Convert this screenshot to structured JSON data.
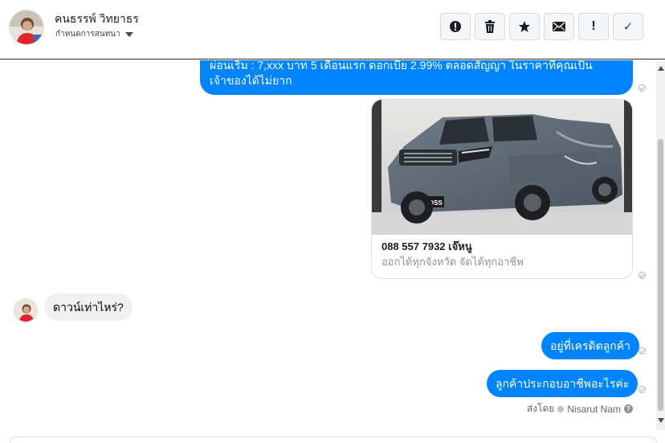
{
  "header": {
    "contact_name": "คนธรรพ์ วิทยาธร",
    "label_dropdown": "กำหนดการสนทนา",
    "toolbar": [
      {
        "name": "spam-button",
        "icon": "alert-circle-icon",
        "label": "!"
      },
      {
        "name": "delete-button",
        "icon": "trash-icon",
        "label": ""
      },
      {
        "name": "star-button",
        "icon": "star-icon",
        "label": ""
      },
      {
        "name": "mark-unread-button",
        "icon": "envelope-icon",
        "label": ""
      },
      {
        "name": "important-button",
        "icon": "exclamation-icon",
        "label": "!"
      },
      {
        "name": "done-button",
        "icon": "checkmark-icon",
        "label": "✓"
      }
    ]
  },
  "messages": {
    "top_bubble_text": "ผ่อนเริ่ม : 7,xxx บาท 5 เดือนแรก ดอกเบี้ย 2.99% ตลอดสัญญา ในราคาที่คุณเป็นเจ้าของได้ไม่ยาก",
    "card": {
      "image_alt": "pickup-truck-photo",
      "plate_text": "LOSS",
      "title": "088 557 7932 เจ๊หนู",
      "subtitle": "ออกได้ทุกจังหวัด จัดได้ทุกอาชีพ"
    },
    "incoming_question": "ดาวน์เท่าไหร่?",
    "reply_1": "อยู่ที่เครดิตลูกค้า",
    "reply_2": "ลูกค้าประกอบอาชีพอะไรค่ะ",
    "sent_by_label": "ส่งโดย",
    "sent_by_name": "Nisarut Nam"
  },
  "colors": {
    "outgoing_bubble": "#0084ff",
    "incoming_bubble": "#f0f0f0",
    "header_border": "#2c2c2c"
  }
}
